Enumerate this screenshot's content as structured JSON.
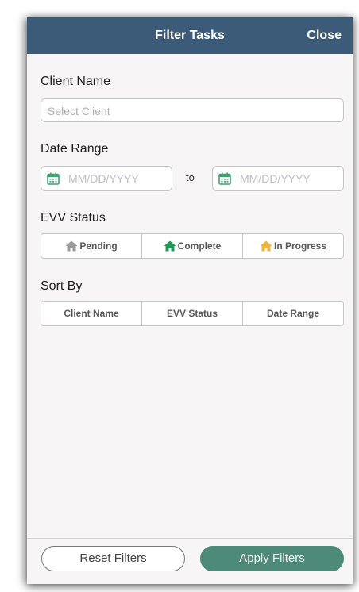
{
  "header": {
    "title": "Filter Tasks",
    "close_label": "Close"
  },
  "client": {
    "label": "Client Name",
    "placeholder": "Select Client"
  },
  "date_range": {
    "label": "Date Range",
    "from_placeholder": "MM/DD/YYYY",
    "separator": "to",
    "to_placeholder": "MM/DD/YYYY"
  },
  "evv_status": {
    "label": "EVV Status",
    "options": [
      {
        "label": "Pending",
        "icon": "house-icon",
        "color": "#9a9a9a"
      },
      {
        "label": "Complete",
        "icon": "house-icon",
        "color": "#1e9a55"
      },
      {
        "label": "In Progress",
        "icon": "house-icon",
        "color": "#f2b53a"
      }
    ]
  },
  "sort_by": {
    "label": "Sort By",
    "options": [
      {
        "label": "Client Name"
      },
      {
        "label": "EVV Status"
      },
      {
        "label": "Date Range"
      }
    ]
  },
  "footer": {
    "reset_label": "Reset Filters",
    "apply_label": "Apply Filters"
  },
  "colors": {
    "header_bg": "#3b5b78",
    "apply_bg": "#4d8a79",
    "calendar_icon": "#3fa36f"
  }
}
